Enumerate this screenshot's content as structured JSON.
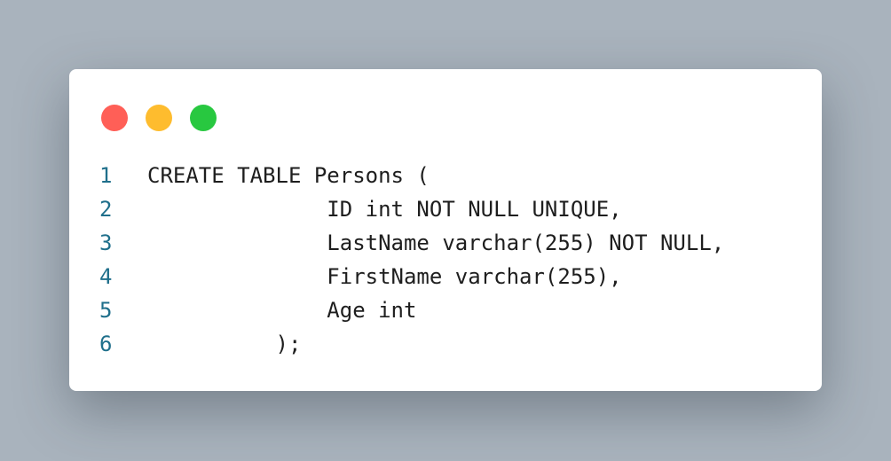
{
  "window": {
    "traffic_lights": [
      {
        "name": "close",
        "color": "#ff5f57"
      },
      {
        "name": "minimize",
        "color": "#febc2e"
      },
      {
        "name": "maximize",
        "color": "#28c840"
      }
    ]
  },
  "code": {
    "line_number_color": "#1f6f8b",
    "lines": [
      {
        "number": "1",
        "text": "CREATE TABLE Persons ("
      },
      {
        "number": "2",
        "text": "              ID int NOT NULL UNIQUE,"
      },
      {
        "number": "3",
        "text": "              LastName varchar(255) NOT NULL,"
      },
      {
        "number": "4",
        "text": "              FirstName varchar(255),"
      },
      {
        "number": "5",
        "text": "              Age int"
      },
      {
        "number": "6",
        "text": "          );"
      }
    ]
  }
}
